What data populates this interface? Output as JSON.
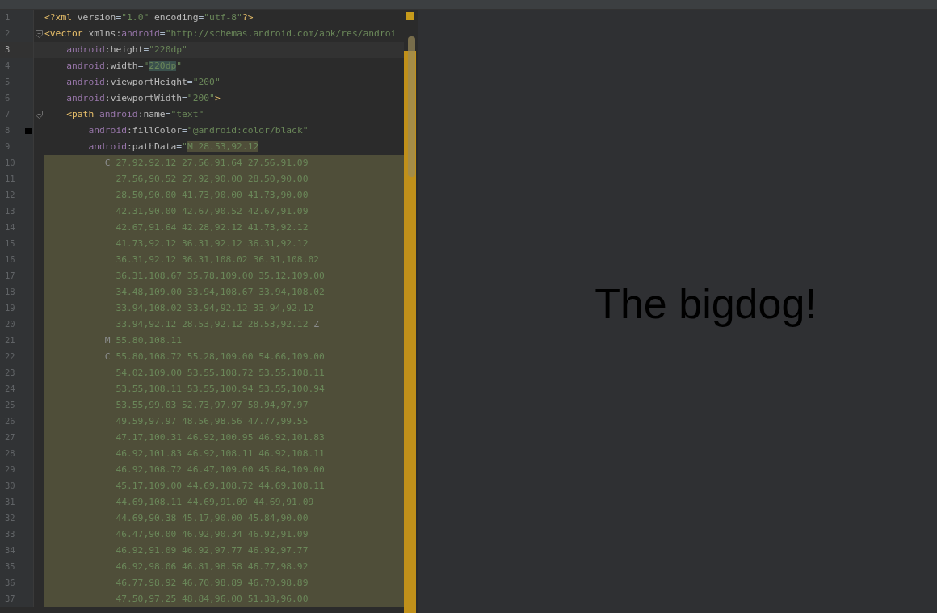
{
  "editor": {
    "lines": [
      {
        "number": "1",
        "current": false,
        "highlighted": false,
        "tokens": [
          {
            "kind": "tag",
            "text": "<?xml"
          },
          {
            "kind": "attr",
            "text": " version"
          },
          {
            "kind": "punct",
            "text": "="
          },
          {
            "kind": "string",
            "text": "\"1.0\""
          },
          {
            "kind": "attr",
            "text": " encoding"
          },
          {
            "kind": "punct",
            "text": "="
          },
          {
            "kind": "string",
            "text": "\"utf-8\""
          },
          {
            "kind": "tag",
            "text": "?>"
          }
        ]
      },
      {
        "number": "2",
        "current": false,
        "highlighted": false,
        "gutter": {
          "kind": "fold"
        },
        "tokens": [
          {
            "kind": "tag",
            "text": "<vector"
          },
          {
            "kind": "attr",
            "text": " xmlns:"
          },
          {
            "kind": "ns",
            "text": "android"
          },
          {
            "kind": "punct",
            "text": "="
          },
          {
            "kind": "string",
            "text": "\"http://schemas.android.com/apk/res/androi"
          }
        ]
      },
      {
        "number": "3",
        "current": true,
        "highlighted": false,
        "tokens": [
          {
            "kind": "ns",
            "text": "    android"
          },
          {
            "kind": "attr",
            "text": ":height"
          },
          {
            "kind": "punct",
            "text": "="
          },
          {
            "kind": "string",
            "text": "\"220dp\""
          }
        ]
      },
      {
        "number": "4",
        "current": false,
        "highlighted": false,
        "tokens": [
          {
            "kind": "ns",
            "text": "    android"
          },
          {
            "kind": "attr",
            "text": ":width"
          },
          {
            "kind": "punct",
            "text": "="
          },
          {
            "kind": "string",
            "text": "\""
          },
          {
            "kind": "match",
            "text": "220dp"
          },
          {
            "kind": "string",
            "text": "\""
          }
        ]
      },
      {
        "number": "5",
        "current": false,
        "highlighted": false,
        "tokens": [
          {
            "kind": "ns",
            "text": "    android"
          },
          {
            "kind": "attr",
            "text": ":viewportHeight"
          },
          {
            "kind": "punct",
            "text": "="
          },
          {
            "kind": "string",
            "text": "\"200\""
          }
        ]
      },
      {
        "number": "6",
        "current": false,
        "highlighted": false,
        "tokens": [
          {
            "kind": "ns",
            "text": "    android"
          },
          {
            "kind": "attr",
            "text": ":viewportWidth"
          },
          {
            "kind": "punct",
            "text": "="
          },
          {
            "kind": "string",
            "text": "\"200\""
          },
          {
            "kind": "tag",
            "text": ">"
          }
        ]
      },
      {
        "number": "7",
        "current": false,
        "highlighted": false,
        "gutter": {
          "kind": "fold"
        },
        "tokens": [
          {
            "kind": "tag",
            "text": "    <path"
          },
          {
            "kind": "ns",
            "text": " android"
          },
          {
            "kind": "attr",
            "text": ":name"
          },
          {
            "kind": "punct",
            "text": "="
          },
          {
            "kind": "string",
            "text": "\"text\""
          }
        ]
      },
      {
        "number": "8",
        "current": false,
        "highlighted": false,
        "gutter": {
          "kind": "swatch"
        },
        "tokens": [
          {
            "kind": "ns",
            "text": "        android"
          },
          {
            "kind": "attr",
            "text": ":fillColor"
          },
          {
            "kind": "punct",
            "text": "="
          },
          {
            "kind": "string",
            "text": "\"@android:color/black\""
          }
        ]
      },
      {
        "number": "9",
        "current": false,
        "highlighted": false,
        "tokens": [
          {
            "kind": "ns",
            "text": "        android"
          },
          {
            "kind": "attr",
            "text": ":pathData"
          },
          {
            "kind": "punct",
            "text": "="
          },
          {
            "kind": "string",
            "text": "\""
          },
          {
            "kind": "path-selected",
            "text": "M 28.53,92.12"
          }
        ]
      },
      {
        "number": "10",
        "current": false,
        "highlighted": true,
        "tokens": [
          {
            "kind": "cmd",
            "text": "           C"
          },
          {
            "kind": "path",
            "text": " 27.92,92.12 27.56,91.64 27.56,91.09"
          }
        ]
      },
      {
        "number": "11",
        "current": false,
        "highlighted": true,
        "tokens": [
          {
            "kind": "path",
            "text": "             27.56,90.52 27.92,90.00 28.50,90.00"
          }
        ]
      },
      {
        "number": "12",
        "current": false,
        "highlighted": true,
        "tokens": [
          {
            "kind": "path",
            "text": "             28.50,90.00 41.73,90.00 41.73,90.00"
          }
        ]
      },
      {
        "number": "13",
        "current": false,
        "highlighted": true,
        "tokens": [
          {
            "kind": "path",
            "text": "             42.31,90.00 42.67,90.52 42.67,91.09"
          }
        ]
      },
      {
        "number": "14",
        "current": false,
        "highlighted": true,
        "tokens": [
          {
            "kind": "path",
            "text": "             42.67,91.64 42.28,92.12 41.73,92.12"
          }
        ]
      },
      {
        "number": "15",
        "current": false,
        "highlighted": true,
        "tokens": [
          {
            "kind": "path",
            "text": "             41.73,92.12 36.31,92.12 36.31,92.12"
          }
        ]
      },
      {
        "number": "16",
        "current": false,
        "highlighted": true,
        "tokens": [
          {
            "kind": "path",
            "text": "             36.31,92.12 36.31,108.02 36.31,108.02"
          }
        ]
      },
      {
        "number": "17",
        "current": false,
        "highlighted": true,
        "tokens": [
          {
            "kind": "path",
            "text": "             36.31,108.67 35.78,109.00 35.12,109.00"
          }
        ]
      },
      {
        "number": "18",
        "current": false,
        "highlighted": true,
        "tokens": [
          {
            "kind": "path",
            "text": "             34.48,109.00 33.94,108.67 33.94,108.02"
          }
        ]
      },
      {
        "number": "19",
        "current": false,
        "highlighted": true,
        "tokens": [
          {
            "kind": "path",
            "text": "             33.94,108.02 33.94,92.12 33.94,92.12"
          }
        ]
      },
      {
        "number": "20",
        "current": false,
        "highlighted": true,
        "tokens": [
          {
            "kind": "path",
            "text": "             33.94,92.12 28.53,92.12 28.53,92.12"
          },
          {
            "kind": "cmd",
            "text": " Z"
          }
        ]
      },
      {
        "number": "21",
        "current": false,
        "highlighted": true,
        "tokens": [
          {
            "kind": "cmd",
            "text": "           M"
          },
          {
            "kind": "path",
            "text": " 55.80,108.11"
          }
        ]
      },
      {
        "number": "22",
        "current": false,
        "highlighted": true,
        "tokens": [
          {
            "kind": "cmd",
            "text": "           C"
          },
          {
            "kind": "path",
            "text": " 55.80,108.72 55.28,109.00 54.66,109.00"
          }
        ]
      },
      {
        "number": "23",
        "current": false,
        "highlighted": true,
        "tokens": [
          {
            "kind": "path",
            "text": "             54.02,109.00 53.55,108.72 53.55,108.11"
          }
        ]
      },
      {
        "number": "24",
        "current": false,
        "highlighted": true,
        "tokens": [
          {
            "kind": "path",
            "text": "             53.55,108.11 53.55,100.94 53.55,100.94"
          }
        ]
      },
      {
        "number": "25",
        "current": false,
        "highlighted": true,
        "tokens": [
          {
            "kind": "path",
            "text": "             53.55,99.03 52.73,97.97 50.94,97.97"
          }
        ]
      },
      {
        "number": "26",
        "current": false,
        "highlighted": true,
        "tokens": [
          {
            "kind": "path",
            "text": "             49.59,97.97 48.56,98.56 47.77,99.55"
          }
        ]
      },
      {
        "number": "27",
        "current": false,
        "highlighted": true,
        "tokens": [
          {
            "kind": "path",
            "text": "             47.17,100.31 46.92,100.95 46.92,101.83"
          }
        ]
      },
      {
        "number": "28",
        "current": false,
        "highlighted": true,
        "tokens": [
          {
            "kind": "path",
            "text": "             46.92,101.83 46.92,108.11 46.92,108.11"
          }
        ]
      },
      {
        "number": "29",
        "current": false,
        "highlighted": true,
        "tokens": [
          {
            "kind": "path",
            "text": "             46.92,108.72 46.47,109.00 45.84,109.00"
          }
        ]
      },
      {
        "number": "30",
        "current": false,
        "highlighted": true,
        "tokens": [
          {
            "kind": "path",
            "text": "             45.17,109.00 44.69,108.72 44.69,108.11"
          }
        ]
      },
      {
        "number": "31",
        "current": false,
        "highlighted": true,
        "tokens": [
          {
            "kind": "path",
            "text": "             44.69,108.11 44.69,91.09 44.69,91.09"
          }
        ]
      },
      {
        "number": "32",
        "current": false,
        "highlighted": true,
        "tokens": [
          {
            "kind": "path",
            "text": "             44.69,90.38 45.17,90.00 45.84,90.00"
          }
        ]
      },
      {
        "number": "33",
        "current": false,
        "highlighted": true,
        "tokens": [
          {
            "kind": "path",
            "text": "             46.47,90.00 46.92,90.34 46.92,91.09"
          }
        ]
      },
      {
        "number": "34",
        "current": false,
        "highlighted": true,
        "tokens": [
          {
            "kind": "path",
            "text": "             46.92,91.09 46.92,97.77 46.92,97.77"
          }
        ]
      },
      {
        "number": "35",
        "current": false,
        "highlighted": true,
        "tokens": [
          {
            "kind": "path",
            "text": "             46.92,98.06 46.81,98.58 46.77,98.92"
          }
        ]
      },
      {
        "number": "36",
        "current": false,
        "highlighted": true,
        "tokens": [
          {
            "kind": "path",
            "text": "             46.77,98.92 46.70,98.89 46.70,98.89"
          }
        ]
      },
      {
        "number": "37",
        "current": false,
        "highlighted": true,
        "tokens": [
          {
            "kind": "path",
            "text": "             47.50,97.25 48.84,96.00 51.38,96.00"
          }
        ]
      }
    ]
  },
  "preview": {
    "text": "The bigdog!"
  }
}
